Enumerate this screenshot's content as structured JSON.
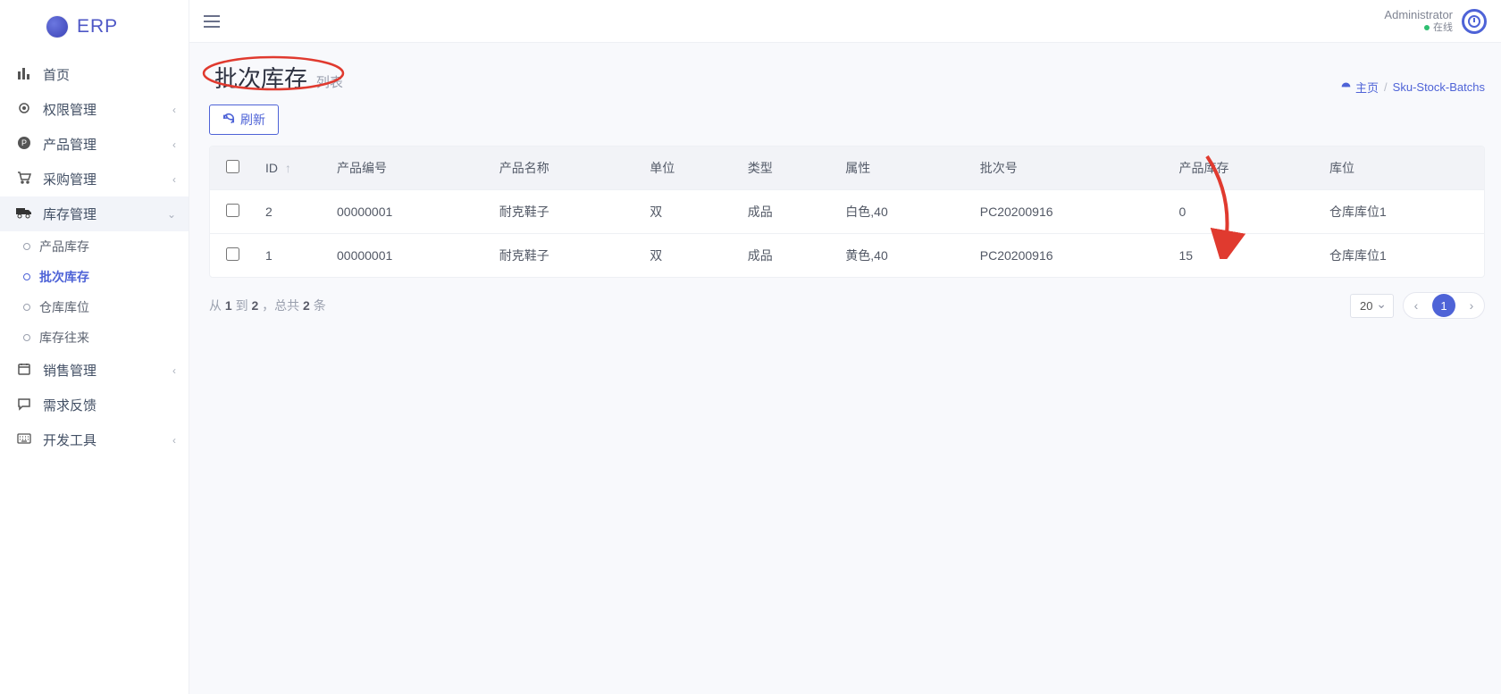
{
  "brand": {
    "name": "ERP"
  },
  "user": {
    "name": "Administrator",
    "status": "在线"
  },
  "nav": {
    "home": "首页",
    "perm": "权限管理",
    "product": "产品管理",
    "purchase": "采购管理",
    "stock": "库存管理",
    "stock_sub": {
      "product_stock": "产品库存",
      "batch_stock": "批次库存",
      "warehouse_loc": "仓库库位",
      "stock_move": "库存往来"
    },
    "sales": "销售管理",
    "feedback": "需求反馈",
    "devtools": "开发工具"
  },
  "page": {
    "title": "批次库存",
    "subtitle": "列表",
    "refresh": "刷新"
  },
  "breadcrumb": {
    "home": "主页",
    "current": "Sku-Stock-Batchs"
  },
  "table": {
    "headers": {
      "id": "ID",
      "code": "产品编号",
      "name": "产品名称",
      "unit": "单位",
      "type": "类型",
      "attr": "属性",
      "batch": "批次号",
      "qty": "产品库存",
      "location": "库位"
    },
    "rows": [
      {
        "id": "2",
        "code": "00000001",
        "name": "耐克鞋子",
        "unit": "双",
        "type": "成品",
        "attr": "白色,40",
        "batch": "PC20200916",
        "qty": "0",
        "location": "仓库库位1"
      },
      {
        "id": "1",
        "code": "00000001",
        "name": "耐克鞋子",
        "unit": "双",
        "type": "成品",
        "attr": "黄色,40",
        "batch": "PC20200916",
        "qty": "15",
        "location": "仓库库位1"
      }
    ]
  },
  "pagination": {
    "info_prefix": "从 ",
    "info_from": "1",
    "info_to_label": " 到 ",
    "info_to": "2",
    "info_total_prefix": " ，总共 ",
    "info_total": "2",
    "info_total_suffix": " 条",
    "per_page": "20",
    "current": "1"
  }
}
